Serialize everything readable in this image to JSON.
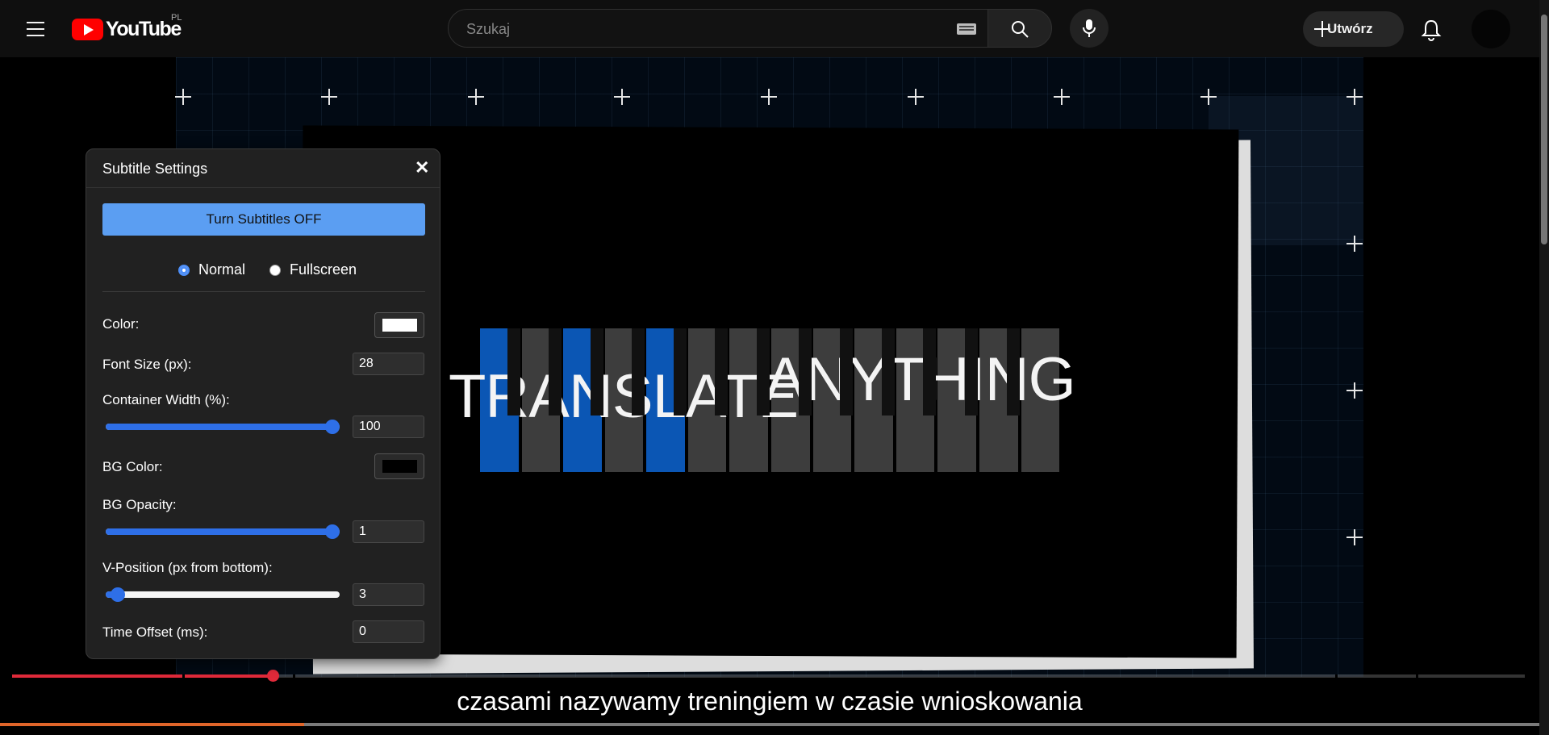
{
  "header": {
    "logo_text": "YouTube",
    "region": "PL",
    "search_placeholder": "Szukaj",
    "create_label": "Utwórz"
  },
  "video": {
    "title_part1": "TRANSLATE",
    "title_part2": "ANYTHING",
    "caption": "czasami nazywamy treningiem w czasie wnioskowania",
    "progress_fraction": 0.172
  },
  "panel": {
    "title": "Subtitle Settings",
    "close_glyph": "✕",
    "toggle_label": "Turn Subtitles OFF",
    "mode_normal": "Normal",
    "mode_fullscreen": "Fullscreen",
    "selected_mode": "Normal",
    "color_label": "Color:",
    "color_value": "#ffffff",
    "font_size_label": "Font Size (px):",
    "font_size_value": "28",
    "container_width_label": "Container Width (%):",
    "container_width_value": "100",
    "bg_color_label": "BG Color:",
    "bg_color_value": "#000000",
    "bg_opacity_label": "BG Opacity:",
    "bg_opacity_value": "1",
    "vpos_label": "V-Position (px from bottom):",
    "vpos_value": "3",
    "time_offset_label": "Time Offset (ms):",
    "time_offset_value": "0",
    "sliders": {
      "container_width_fraction": 0.97,
      "bg_opacity_fraction": 0.97,
      "vpos_fraction": 0.05
    }
  },
  "colors": {
    "accent": "#5b9ef2",
    "slider": "#2e6fe8",
    "progress": "#e02a3a"
  }
}
